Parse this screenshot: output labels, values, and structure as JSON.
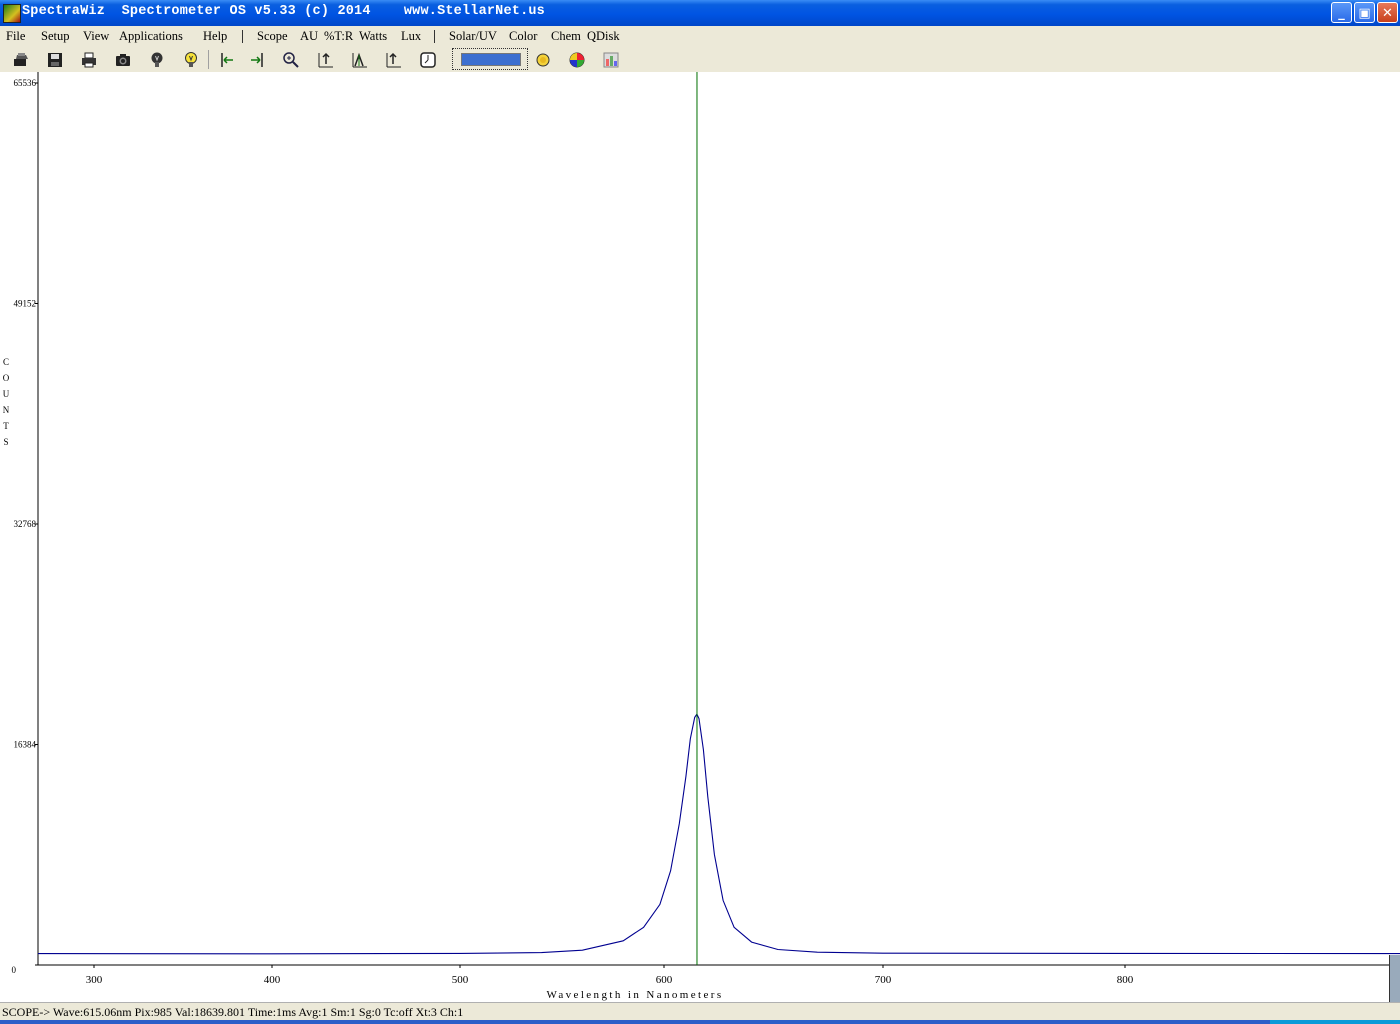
{
  "window": {
    "title": "SpectraWiz  Spectrometer OS v5.33 (c) 2014    www.StellarNet.us",
    "buttons": {
      "minimize": "_",
      "maximize": "▣",
      "close": "✕"
    }
  },
  "menu": {
    "left": [
      {
        "label": "File"
      },
      {
        "label": "Setup"
      },
      {
        "label": "View"
      },
      {
        "label": "Applications"
      },
      {
        "label": "Help"
      }
    ],
    "mid": [
      {
        "label": "Scope"
      },
      {
        "label": "AU"
      },
      {
        "label": "%T:R"
      },
      {
        "label": "Watts"
      },
      {
        "label": "Lux"
      }
    ],
    "right": [
      {
        "label": "Solar/UV"
      },
      {
        "label": "Color"
      },
      {
        "label": "Chem"
      },
      {
        "label": "QDisk"
      }
    ]
  },
  "toolbar": {
    "icons": [
      "open-icon",
      "save-icon",
      "print-icon",
      "camera-icon",
      "dark-bulb-icon",
      "light-bulb-icon",
      "cursor-left-icon",
      "cursor-right-icon",
      "zoom-icon",
      "autoscale-icon",
      "peak-icon",
      "baseline-icon",
      "timer-icon",
      "sun-icon",
      "color-wheel-icon",
      "chart3d-icon"
    ],
    "progress_level": 1.0,
    "progress_color": "#3c6fd0"
  },
  "chart_data": {
    "type": "line",
    "xlabel": "Wavelength in Nanometers",
    "ylabel": "COUNTS",
    "ylabel_letters": [
      "C",
      "O",
      "U",
      "N",
      "T",
      "S"
    ],
    "ylim": [
      0,
      65536
    ],
    "xlim": [
      272,
      1000
    ],
    "yticks": [
      {
        "value": 65536,
        "label": "65536"
      },
      {
        "value": 49152,
        "label": "49152"
      },
      {
        "value": 32768,
        "label": "32768"
      },
      {
        "value": 16384,
        "label": "16384"
      },
      {
        "value": 0,
        "label": "0"
      }
    ],
    "xticks": [
      300,
      400,
      500,
      600,
      700,
      800
    ],
    "x_tick_positions_note": "nonlinear pixel mapping",
    "cursor_wavelength": 615.06,
    "series": [
      {
        "color": "#000090",
        "baseline": 850,
        "peak_wavelength": 615,
        "peak_value": 18640,
        "points": [
          [
            272,
            850
          ],
          [
            400,
            830
          ],
          [
            500,
            860
          ],
          [
            540,
            920
          ],
          [
            560,
            1100
          ],
          [
            580,
            1800
          ],
          [
            590,
            2800
          ],
          [
            598,
            4500
          ],
          [
            603,
            7000
          ],
          [
            607,
            10500
          ],
          [
            610,
            14000
          ],
          [
            612,
            16800
          ],
          [
            614,
            18400
          ],
          [
            615,
            18640
          ],
          [
            616,
            18300
          ],
          [
            618,
            16000
          ],
          [
            620,
            12500
          ],
          [
            623,
            8200
          ],
          [
            627,
            4800
          ],
          [
            632,
            2800
          ],
          [
            640,
            1700
          ],
          [
            652,
            1150
          ],
          [
            670,
            950
          ],
          [
            700,
            880
          ],
          [
            800,
            860
          ],
          [
            900,
            850
          ],
          [
            1000,
            850
          ]
        ]
      }
    ],
    "cursor_color": "#007000"
  },
  "status": {
    "text": "SCOPE->  Wave:615.06nm  Pix:985  Val:18639.801  Time:1ms  Avg:1  Sm:1  Sg:0  Tc:off  Xt:3  Ch:1"
  }
}
